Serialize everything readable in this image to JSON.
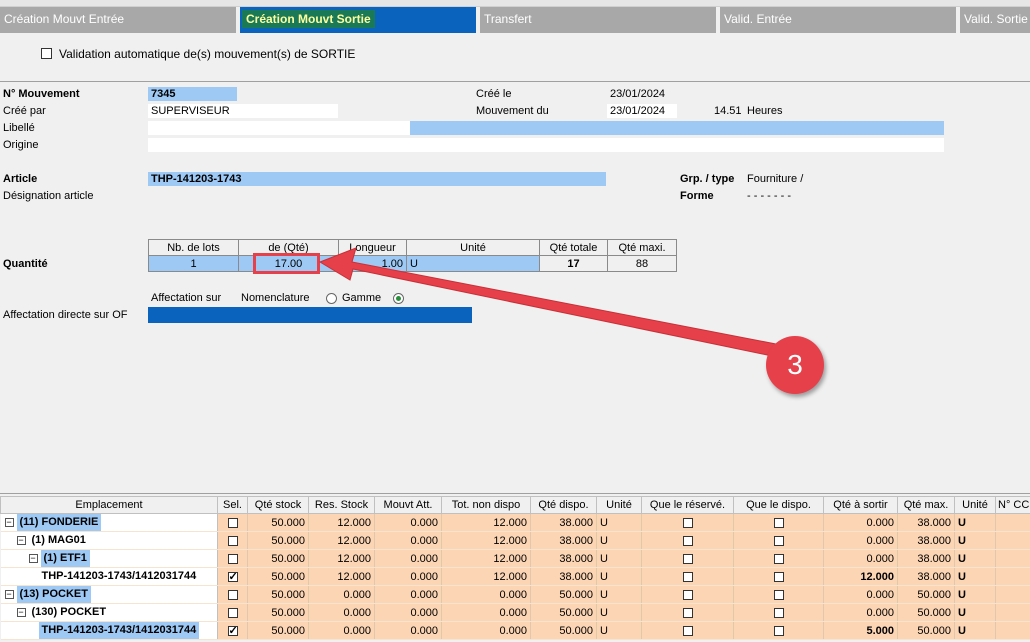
{
  "tabs": [
    {
      "label": "Création Mouvt Entrée",
      "active": false
    },
    {
      "label": "Création Mouvt Sortie",
      "active": true
    },
    {
      "label": "Transfert",
      "active": false
    },
    {
      "label": "Valid. Entrée",
      "active": false
    },
    {
      "label": "Valid. Sortie",
      "active": false
    }
  ],
  "auto_validation_label": "Validation automatique de(s) mouvement(s) de SORTIE",
  "form": {
    "num_mouvement_label": "N° Mouvement",
    "num_mouvement": "7345",
    "cree_par_label": "Créé par",
    "cree_par": "SUPERVISEUR",
    "libelle_label": "Libellé",
    "origine_label": "Origine",
    "cree_le_label": "Créé le",
    "cree_le": "23/01/2024",
    "mouvement_du_label": "Mouvement du",
    "mouvement_du": "23/01/2024",
    "heure": "14.51",
    "heures_label": "Heures",
    "article_label": "Article",
    "article": "THP-141203-1743",
    "designation_label": "Désignation article",
    "grp_type_label": "Grp. / type",
    "grp_type": "Fourniture /",
    "forme_label": "Forme",
    "forme": "- - - - - - -"
  },
  "quantite": {
    "label": "Quantité",
    "headers": [
      "Nb. de lots",
      "de (Qté)",
      "Longueur",
      "Unité",
      "Qté totale",
      "Qté maxi."
    ],
    "values": [
      "1",
      "17.00",
      "1.00",
      "U",
      "17",
      "88"
    ]
  },
  "affectation": {
    "sur_label": "Affectation sur",
    "nomenclature_label": "Nomenclature",
    "gamme_label": "Gamme",
    "selected": "Gamme",
    "directe_label": "Affectation directe sur OF"
  },
  "callout": {
    "number": "3",
    "color": "#e6404a"
  },
  "grid": {
    "headers": [
      "Emplacement",
      "Sel.",
      "Qté stock",
      "Res. Stock",
      "Mouvt Att.",
      "Tot. non dispo",
      "Qté dispo.",
      "Unité",
      "Que le réservé.",
      "Que le dispo.",
      "Qté à sortir",
      "Qté max.",
      "Unité",
      "N° CC"
    ],
    "rows": [
      {
        "indent": 0,
        "toggle": "−",
        "label": "(11)  FONDERIE",
        "hl": true,
        "sel": false,
        "stock": "50.000",
        "res": "12.000",
        "att": "0.000",
        "nondispo": "12.000",
        "dispo": "38.000",
        "unite": "U",
        "qr": false,
        "qd": false,
        "sortir": "0.000",
        "max": "38.000",
        "unite2": "U",
        "bold_sortir": false
      },
      {
        "indent": 1,
        "toggle": "−",
        "label": "(1)  MAG01",
        "hl": false,
        "sel": false,
        "stock": "50.000",
        "res": "12.000",
        "att": "0.000",
        "nondispo": "12.000",
        "dispo": "38.000",
        "unite": "U",
        "qr": false,
        "qd": false,
        "sortir": "0.000",
        "max": "38.000",
        "unite2": "U",
        "bold_sortir": false
      },
      {
        "indent": 2,
        "toggle": "−",
        "label": "(1)  ETF1",
        "hl": true,
        "sel": false,
        "stock": "50.000",
        "res": "12.000",
        "att": "0.000",
        "nondispo": "12.000",
        "dispo": "38.000",
        "unite": "U",
        "qr": false,
        "qd": false,
        "sortir": "0.000",
        "max": "38.000",
        "unite2": "U",
        "bold_sortir": false
      },
      {
        "indent": 3,
        "toggle": "",
        "label": "THP-141203-1743/1412031744",
        "hl": false,
        "sel": true,
        "stock": "50.000",
        "res": "12.000",
        "att": "0.000",
        "nondispo": "12.000",
        "dispo": "38.000",
        "unite": "U",
        "qr": false,
        "qd": false,
        "sortir": "12.000",
        "max": "38.000",
        "unite2": "U",
        "bold_sortir": true
      },
      {
        "indent": 0,
        "toggle": "−",
        "label": "(13)  POCKET",
        "hl": true,
        "sel": false,
        "stock": "50.000",
        "res": "0.000",
        "att": "0.000",
        "nondispo": "0.000",
        "dispo": "50.000",
        "unite": "U",
        "qr": false,
        "qd": false,
        "sortir": "0.000",
        "max": "50.000",
        "unite2": "U",
        "bold_sortir": false
      },
      {
        "indent": 1,
        "toggle": "−",
        "label": "(130)  POCKET",
        "hl": false,
        "sel": false,
        "stock": "50.000",
        "res": "0.000",
        "att": "0.000",
        "nondispo": "0.000",
        "dispo": "50.000",
        "unite": "U",
        "qr": false,
        "qd": false,
        "sortir": "0.000",
        "max": "50.000",
        "unite2": "U",
        "bold_sortir": false
      },
      {
        "indent": 3,
        "toggle": "",
        "label": "THP-141203-1743/1412031744",
        "hl": true,
        "sel": true,
        "stock": "50.000",
        "res": "0.000",
        "att": "0.000",
        "nondispo": "0.000",
        "dispo": "50.000",
        "unite": "U",
        "qr": false,
        "qd": false,
        "sortir": "5.000",
        "max": "50.000",
        "unite2": "U",
        "bold_sortir": true
      }
    ]
  }
}
